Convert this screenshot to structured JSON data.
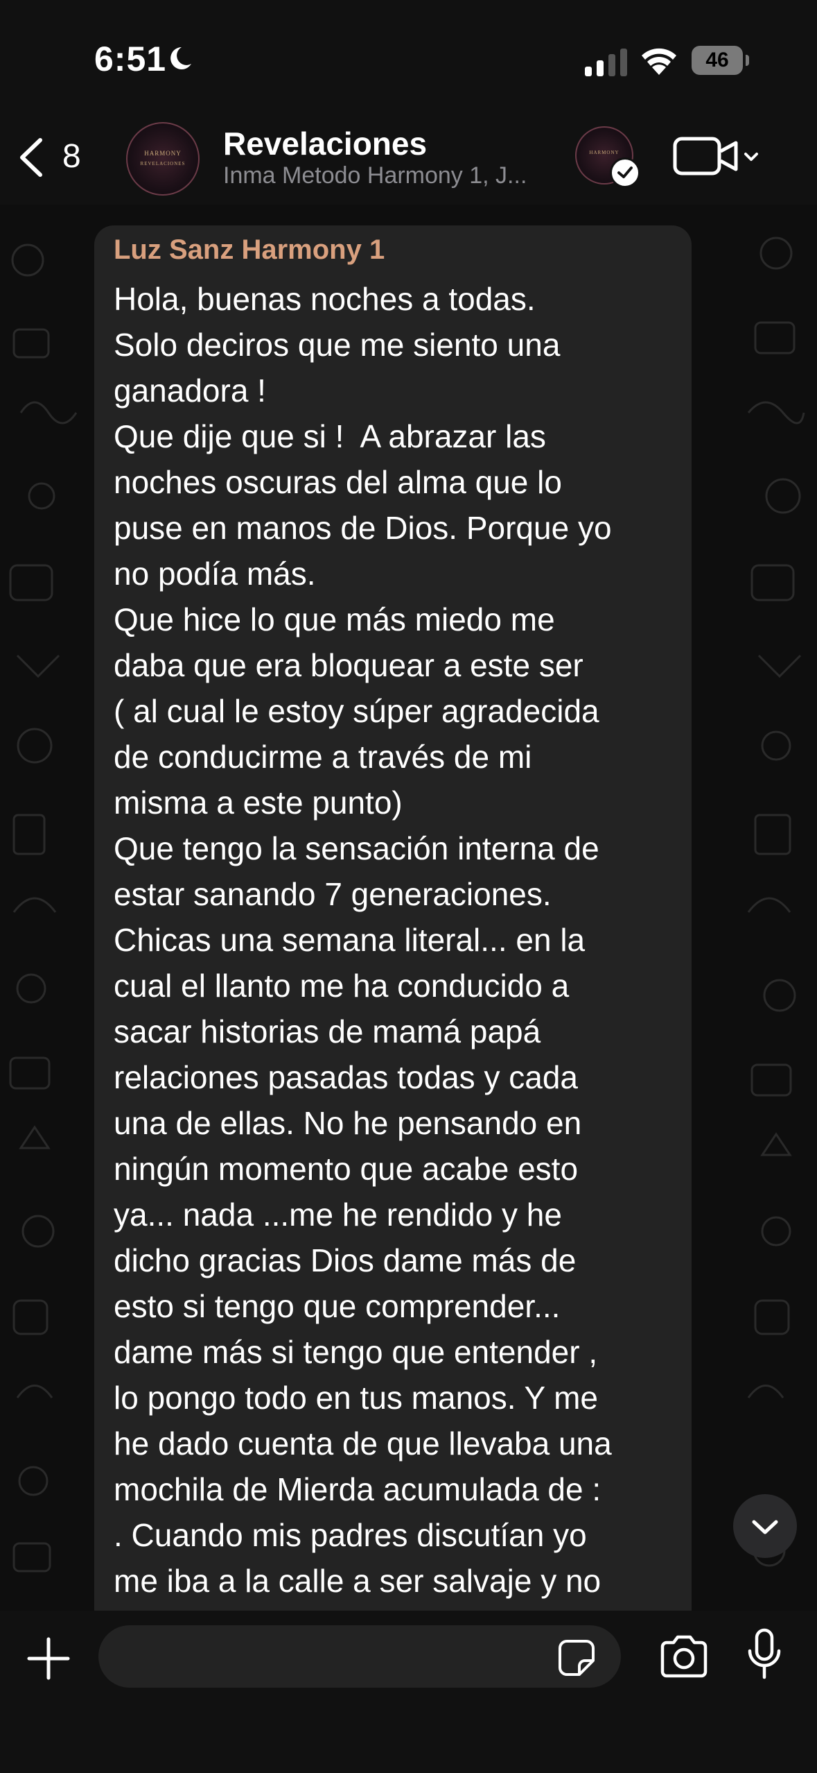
{
  "status_bar": {
    "time": "6:51",
    "battery": "46"
  },
  "header": {
    "back_count": "8",
    "group_name": "Revelaciones",
    "subtitle": "Inma Metodo Harmony 1, J...",
    "avatar_text_top": "HARMONY",
    "avatar_text_bottom": "REVELACIONES",
    "icons": [
      "back-chevron-icon",
      "video-call-icon",
      "chevron-down-icon",
      "checkmark-badge-icon"
    ]
  },
  "message": {
    "sender": "Luz Sanz Harmony 1",
    "sender_color": "#d9a07e",
    "text": "Hola, buenas noches a todas.\nSolo deciros que me siento una\nganadora !\nQue dije que si !  A abrazar las\nnoches oscuras del alma que lo\npuse en manos de Dios. Porque yo\nno podía más.\nQue hice lo que más miedo me\ndaba que era bloquear a este ser\n( al cual le estoy súper agradecida\nde conducirme a través de mi\nmisma a este punto)\nQue tengo la sensación interna de\nestar sanando 7 generaciones.\nChicas una semana literal... en la\ncual el llanto me ha conducido a\nsacar historias de mamá papá\nrelaciones pasadas todas y cada\nuna de ellas. No he pensando en\nningún momento que acabe esto\nya... nada ...me he rendido y he\ndicho gracias Dios dame más de\nesto si tengo que comprender...\ndame más si tengo que entender ,\nlo pongo todo en tus manos. Y me\nhe dado cuenta de que llevaba una\nmochila de Mierda acumulada de :\n. Cuando mis padres discutían yo\nme iba a la calle a ser salvaje y no"
  },
  "input_bar": {
    "placeholder": "",
    "icons": [
      "plus-icon",
      "sticker-icon",
      "camera-icon",
      "microphone-icon"
    ]
  },
  "colors": {
    "background": "#0b0b0b",
    "bubble": "#232323",
    "bars": "#111111"
  }
}
